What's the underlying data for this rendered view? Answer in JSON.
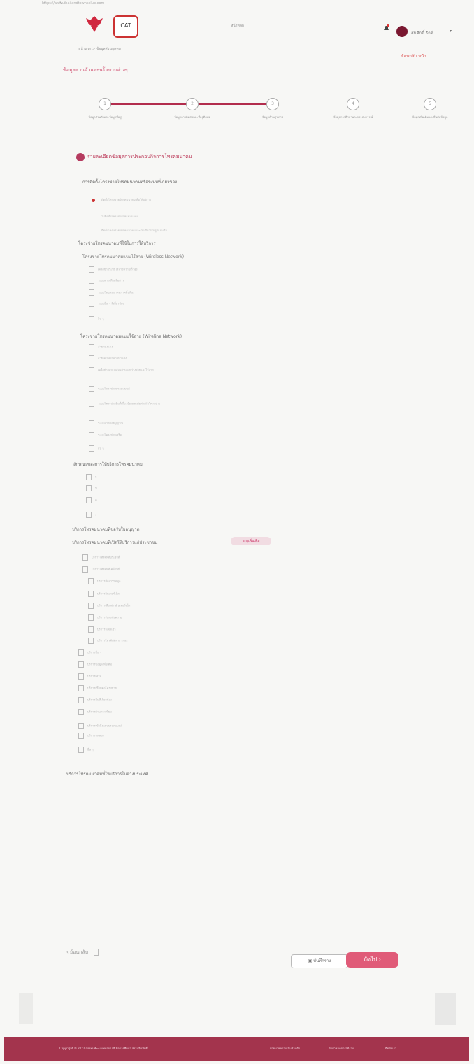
{
  "browser": {
    "url": "https://www.thailandtownsclub.com"
  },
  "header": {
    "title": "หน้าหลัก",
    "user": "สมศักดิ์ รักดี",
    "breadcrumb": "หน้าแรก > ข้อมูลส่วนบุคคล",
    "pager": "ย้อนกลับ หน้า"
  },
  "page_heading": "ข้อมูลส่วนตัวและนโยบายต่างๆ",
  "steps": [
    {
      "num": "1",
      "label": "ข้อมูลส่วนตัวและข้อมูลที่อยู่"
    },
    {
      "num": "2",
      "label": "ข้อมูลการติดต่อและที่อยู่ติดต่อ"
    },
    {
      "num": "3",
      "label": "ข้อมูลด้านสุขภาพ"
    },
    {
      "num": "4",
      "label": "ข้อมูลการศึกษาและประสบการณ์"
    },
    {
      "num": "5",
      "label": "ข้อมูลเพิ่มเติมและยืนยันข้อมูล"
    }
  ],
  "sections": {
    "main": "รายละเอียดข้อมูลการประกอบกิจการโทรคมนาคม",
    "q1": "การติดตั้งโครงข่ายโทรคมนาคมหรือระบบที่เกี่ยวข้อง",
    "radio_options": [
      "ติดตั้งโครงข่ายโทรคมนาคมเพื่อให้บริการ",
      "ไม่ติดตั้งโครงข่ายโทรคมนาคม",
      "ติดตั้งโครงข่ายโทรคมนาคมและให้บริการในรูปแบบอื่น"
    ],
    "q2": "โครงข่ายโทรคมนาคมที่ใช้ในการให้บริการ",
    "q3": "โครงข่ายโทรคมนาคมแบบไร้สาย (Wireless Network)",
    "wireless": [
      "เครือข่ายระบบไร้สายความเร็วสูง",
      "ระบบดาวเทียมสื่อสาร",
      "ระบบวิทยุคมนาคมภาคพื้นดิน",
      "ระบบอื่น ๆ ที่เกี่ยวข้อง",
      "อื่น ๆ"
    ],
    "q4": "โครงข่ายโทรคมนาคมแบบใช้สาย (Wireline Network)",
    "wireline": [
      "สายทองแดง",
      "สายเคเบิลใยแก้วนำแสง",
      "เครือข่ายแบบผสมผสานระหว่างสายและไร้สาย",
      "ระบบโครงข่ายบรอดแบนด์",
      "ระบบโครงข่ายอื่นที่เกี่ยวข้องและต่อพ่วงกับโครงข่าย",
      "ระบบสายส่งสัญญาณ",
      "ระบบโครงข่ายเสริม",
      "อื่น ๆ"
    ],
    "q5": "ลักษณะของการให้บริการโทรคมนาคม",
    "service_types": [
      "ก",
      "ข",
      "ค",
      "ง"
    ],
    "q6": "บริการโทรคมนาคมที่ขอรับใบอนุญาต",
    "q7": "บริการโทรคมนาคมที่เปิดให้บริการแก่ประชาชน",
    "pill": "ระบุเพิ่มเติม",
    "services": [
      "บริการโทรศัพท์ประจำที่",
      "บริการโทรศัพท์เคลื่อนที่",
      "บริการสื่อสารข้อมูล",
      "บริการอินเทอร์เน็ต",
      "บริการเสียงผ่านอินเทอร์เน็ต",
      "บริการรับส่งข้อความ",
      "บริการวงจรเช่า",
      "บริการโทรศัพท์สาธารณะ",
      "บริการอื่น ๆ",
      "บริการข้อมูลเพิ่มเติม",
      "บริการเสริม",
      "บริการเชื่อมต่อโครงข่าย",
      "บริการอื่นที่เกี่ยวข้อง",
      "บริการผ่านดาวเทียม",
      "บริการเข้าถึงแบบบรอดแบนด์",
      "บริการทดลอง",
      "อื่น ๆ"
    ],
    "q8": "บริการโทรคมนาคมที่ให้บริการในต่างประเทศ"
  },
  "buttons": {
    "back": "ย้อนกลับ",
    "save": "บันทึกร่าง",
    "next": "ถัดไป"
  },
  "footer": {
    "copyright": "Copyright © 2022 กองทุนพัฒนาเทคโนโลยีเพื่อการศึกษา สงวนลิขสิทธิ์",
    "link1": "นโยบายความเป็นส่วนตัว",
    "link2": "ข้อกำหนดการใช้งาน",
    "link3": "ติดต่อเรา"
  }
}
